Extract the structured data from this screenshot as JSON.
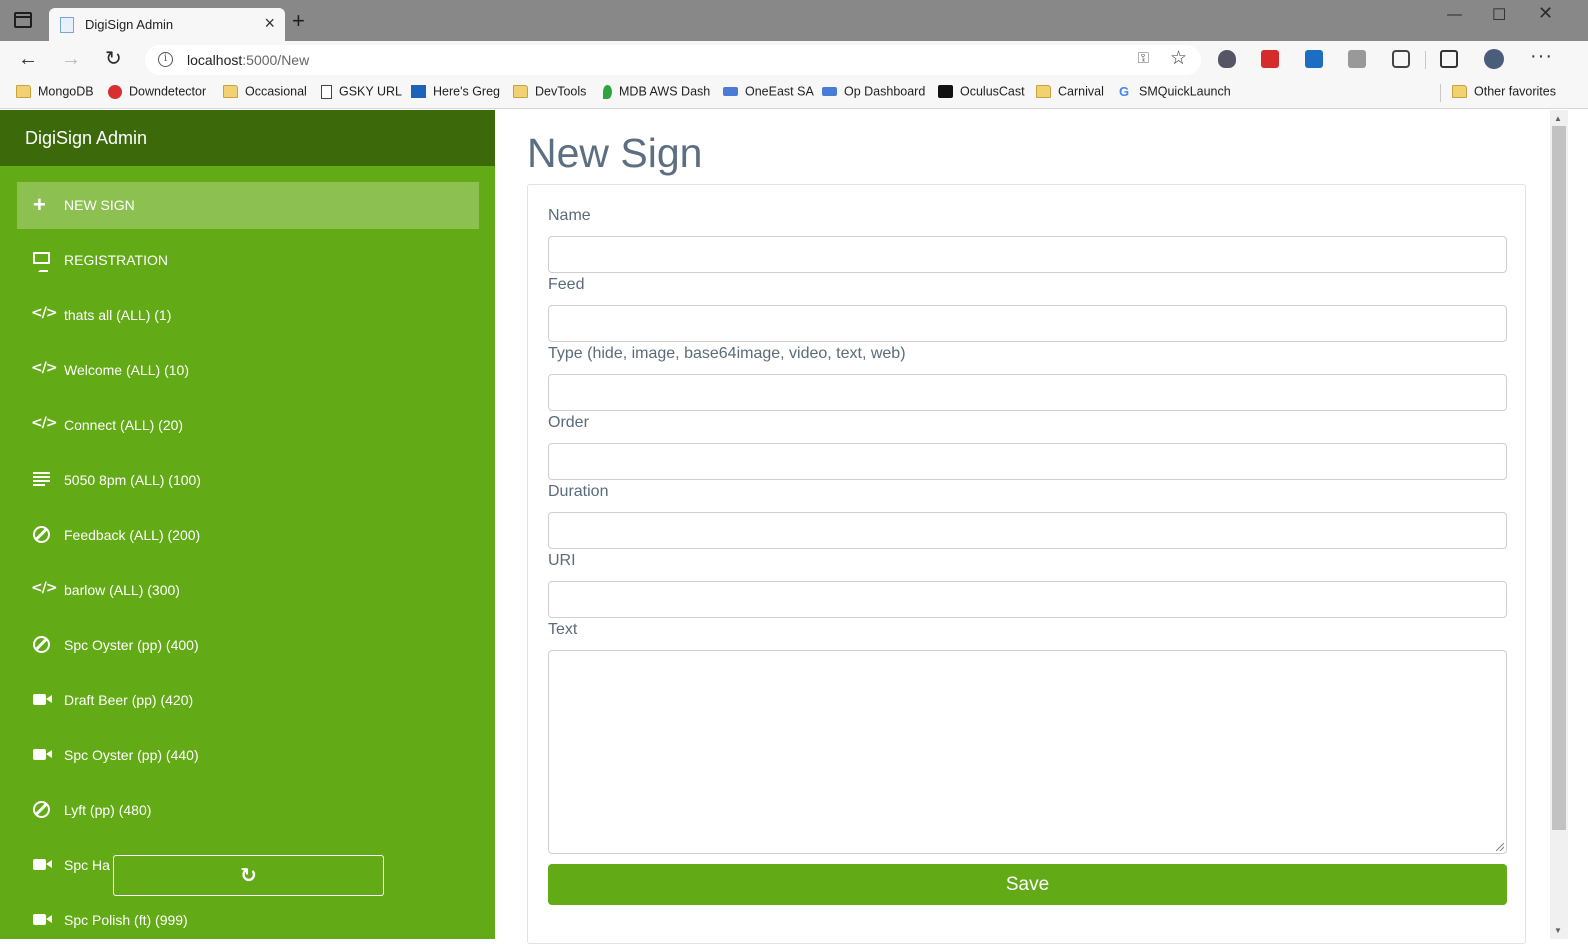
{
  "browser": {
    "tab_title": "DigiSign Admin",
    "url_host": "localhost",
    "url_path": ":5000/New",
    "bookmarks": [
      {
        "label": "MongoDB",
        "icon": "folder-icon"
      },
      {
        "label": "Downdetector",
        "icon": "downdetector-icon"
      },
      {
        "label": "Occasional",
        "icon": "folder-icon"
      },
      {
        "label": "GSKY URL",
        "icon": "page-icon"
      },
      {
        "label": "Here's Greg",
        "icon": "greg-icon"
      },
      {
        "label": "DevTools",
        "icon": "folder-icon"
      },
      {
        "label": "MDB AWS Dash",
        "icon": "leaf-icon"
      },
      {
        "label": "OneEast SA",
        "icon": "flow-icon"
      },
      {
        "label": "Op Dashboard",
        "icon": "flow-icon"
      },
      {
        "label": "OculusCast",
        "icon": "oculus-icon"
      },
      {
        "label": "Carnival",
        "icon": "folder-icon"
      },
      {
        "label": "SMQuickLaunch",
        "icon": "google-icon"
      }
    ],
    "other_favorites": "Other favorites"
  },
  "app": {
    "brand": "DigiSign Admin",
    "nav": [
      {
        "label": "NEW SIGN",
        "icon": "plus-icon",
        "active": true
      },
      {
        "label": "REGISTRATION",
        "icon": "monitor-icon"
      },
      {
        "label": "thats all (ALL) (1)",
        "icon": "code-icon"
      },
      {
        "label": "Welcome (ALL) (10)",
        "icon": "code-icon"
      },
      {
        "label": "Connect (ALL) (20)",
        "icon": "code-icon"
      },
      {
        "label": "5050 8pm (ALL) (100)",
        "icon": "text-lines-icon"
      },
      {
        "label": "Feedback (ALL) (200)",
        "icon": "ban-icon"
      },
      {
        "label": "barlow (ALL) (300)",
        "icon": "code-icon"
      },
      {
        "label": "Spc Oyster (pp) (400)",
        "icon": "ban-icon"
      },
      {
        "label": "Draft Beer (pp) (420)",
        "icon": "video-icon"
      },
      {
        "label": "Spc Oyster (pp) (440)",
        "icon": "video-icon"
      },
      {
        "label": "Lyft (pp) (480)",
        "icon": "ban-icon"
      },
      {
        "label": "Spc Ha",
        "icon": "video-icon"
      },
      {
        "label": "Spc Polish (ft) (999)",
        "icon": "video-icon"
      }
    ],
    "refresh_icon": "refresh-icon"
  },
  "form": {
    "title": "New Sign",
    "fields": [
      {
        "label": "Name",
        "value": ""
      },
      {
        "label": "Feed",
        "value": ""
      },
      {
        "label": "Type (hide, image, base64image, video, text, web)",
        "value": ""
      },
      {
        "label": "Order",
        "value": ""
      },
      {
        "label": "Duration",
        "value": ""
      },
      {
        "label": "URI",
        "value": ""
      },
      {
        "label": "Text",
        "value": ""
      }
    ],
    "save_label": "Save"
  },
  "colors": {
    "sidebar": "#63aa17",
    "brand_bar": "#3c6a0b",
    "active_item": "#8cc152",
    "title": "#5c6f80"
  }
}
